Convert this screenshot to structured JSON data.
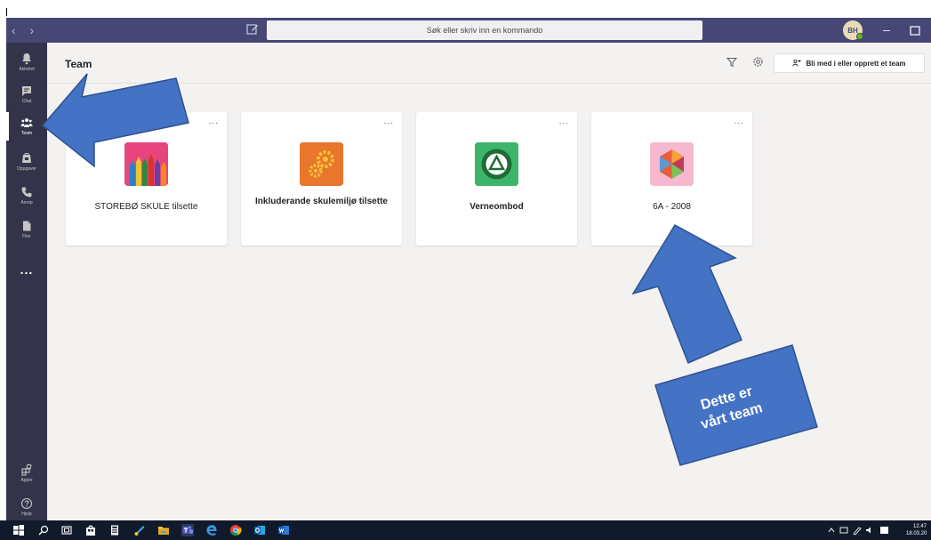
{
  "titlebar": {
    "nav_arrows": "‹ ›",
    "search_placeholder": "Søk eller skriv inn en kommando",
    "avatar_initials": "BH"
  },
  "rail": {
    "items": [
      {
        "label": "Aktivitet",
        "icon": "bell-icon"
      },
      {
        "label": "Chat",
        "icon": "chat-icon"
      },
      {
        "label": "Team",
        "icon": "teams-icon",
        "active": true
      },
      {
        "label": "Oppgaver",
        "icon": "assignments-icon"
      },
      {
        "label": "Anrop",
        "icon": "phone-icon"
      },
      {
        "label": "Filer",
        "icon": "file-icon"
      }
    ],
    "more": "...",
    "bottom": [
      {
        "label": "Apper",
        "icon": "apps-icon"
      },
      {
        "label": "Hjelp",
        "icon": "help-icon"
      }
    ]
  },
  "header": {
    "title": "Team",
    "join_button": "Bli med i eller opprett et team"
  },
  "teams": [
    {
      "name": "STOREBØ SKULE tilsette",
      "bold": false,
      "icon": "pencils-icon",
      "more": "..."
    },
    {
      "name": "Inkluderande skulemiljø tilsette",
      "bold": true,
      "icon": "gears-icon",
      "more": "..."
    },
    {
      "name": "Verneombod",
      "bold": true,
      "icon": "verneombod-logo-icon",
      "more": "..."
    },
    {
      "name": "6A - 2008",
      "bold": false,
      "icon": "polyhedron-icon",
      "more": "..."
    }
  ],
  "annotation": {
    "label": "Dette er vårt team",
    "color": "#4472c4"
  },
  "taskbar": {
    "time": "12.47",
    "date": "18.03.20"
  },
  "colors": {
    "titlebar": "#464775",
    "rail": "#33344a",
    "canvas": "#f3f2f1",
    "taskbar": "#101a2b",
    "accent": "#6264a7"
  }
}
